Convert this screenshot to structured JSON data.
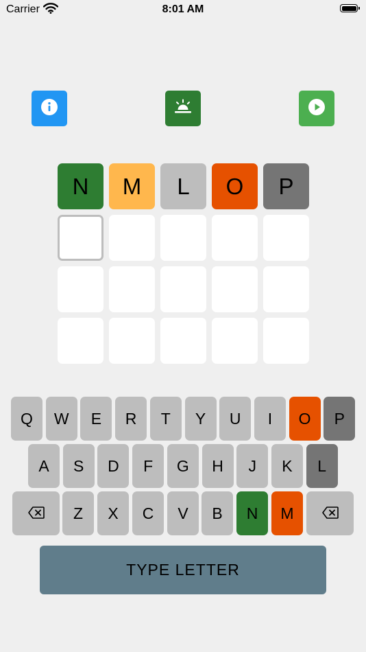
{
  "status_bar": {
    "carrier": "Carrier",
    "time": "8:01 AM"
  },
  "toolbar": {
    "info_icon": "info-icon",
    "hint_icon": "sunrise-bell-icon",
    "play_icon": "play-icon"
  },
  "colors": {
    "background": "#efefef",
    "correct": "#2e7d32",
    "present": "#ffb74d",
    "absent_light": "#bdbdbd",
    "orange": "#e65100",
    "absent_dark": "#757575",
    "info_button": "#2196f3",
    "hint_button": "#2e7d32",
    "play_button": "#4caf50",
    "type_letter_button": "#607d8b"
  },
  "board": {
    "rows": [
      {
        "letters": [
          "N",
          "M",
          "L",
          "O",
          "P"
        ],
        "states": [
          "green",
          "yellow",
          "lgray",
          "orange",
          "dgray"
        ]
      },
      {
        "letters": [
          "",
          "",
          "",
          "",
          ""
        ],
        "states": [
          "active",
          "empty",
          "empty",
          "empty",
          "empty"
        ]
      },
      {
        "letters": [
          "",
          "",
          "",
          "",
          ""
        ],
        "states": [
          "empty",
          "empty",
          "empty",
          "empty",
          "empty"
        ]
      },
      {
        "letters": [
          "",
          "",
          "",
          "",
          ""
        ],
        "states": [
          "empty",
          "empty",
          "empty",
          "empty",
          "empty"
        ]
      }
    ]
  },
  "keyboard": {
    "rows": [
      [
        {
          "label": "Q"
        },
        {
          "label": "W"
        },
        {
          "label": "E"
        },
        {
          "label": "R"
        },
        {
          "label": "T"
        },
        {
          "label": "Y"
        },
        {
          "label": "U"
        },
        {
          "label": "I"
        },
        {
          "label": "O",
          "state": "orange"
        },
        {
          "label": "P",
          "state": "dgray"
        }
      ],
      [
        {
          "label": "A"
        },
        {
          "label": "S"
        },
        {
          "label": "D"
        },
        {
          "label": "F"
        },
        {
          "label": "G"
        },
        {
          "label": "H"
        },
        {
          "label": "J"
        },
        {
          "label": "K"
        },
        {
          "label": "L",
          "state": "dgray"
        }
      ],
      [
        {
          "label": "",
          "icon": "backspace-icon"
        },
        {
          "label": "Z"
        },
        {
          "label": "X"
        },
        {
          "label": "C"
        },
        {
          "label": "V"
        },
        {
          "label": "B"
        },
        {
          "label": "N",
          "state": "green"
        },
        {
          "label": "M",
          "state": "orange"
        },
        {
          "label": "",
          "icon": "backspace-icon"
        }
      ]
    ]
  },
  "action": {
    "type_letter": "TYPE LETTER"
  }
}
